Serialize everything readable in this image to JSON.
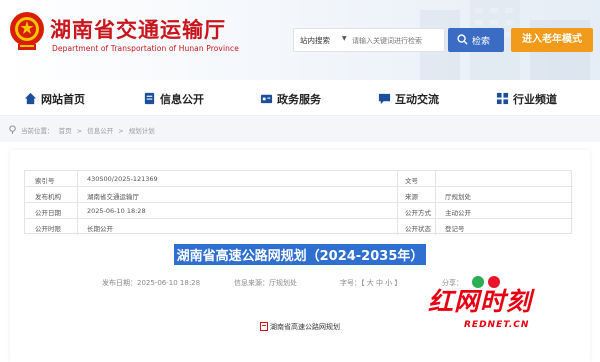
{
  "header": {
    "site_title": "湖南省交通运输厅",
    "site_subtitle": "Department of Transportation of Hunan Province",
    "search": {
      "scope": "站内搜索",
      "placeholder": "请输入关键词进行检索",
      "button_label": "检索"
    },
    "elder_mode_label": "进入老年模式",
    "colors": {
      "brand_red": "#c8161d",
      "search_blue": "#3b6cc4",
      "elder_orange": "#f29b1a"
    }
  },
  "nav": {
    "items": [
      {
        "label": "网站首页",
        "icon": "home-icon"
      },
      {
        "label": "信息公开",
        "icon": "document-icon"
      },
      {
        "label": "政务服务",
        "icon": "service-icon"
      },
      {
        "label": "互动交流",
        "icon": "chat-icon"
      },
      {
        "label": "行业频道",
        "icon": "grid-icon"
      }
    ]
  },
  "breadcrumb": {
    "prefix": "当前位置：",
    "items": [
      "首页",
      "信息公开",
      "规划计划"
    ],
    "separator": ">"
  },
  "meta": {
    "index_label": "索引号",
    "index_value": "430S00/2025-121369",
    "doc_no_label": "文号",
    "doc_no_value": "",
    "publisher_label": "发布机构",
    "publisher_value": "湖南省交通运输厅",
    "source_label": "来源",
    "source_value": "厅规划处",
    "date_label": "公开日期",
    "date_value": "2025-06-10 18:28",
    "method_label": "公开方式",
    "method_value": "主动公开",
    "period_label": "公开时限",
    "period_value": "长期公开",
    "status_label": "公开状态",
    "status_value": "登记号"
  },
  "article": {
    "title": "湖南省高速公路网规划（2024-2035年）",
    "publish_date": "发布日期：2025-06-10 18:28",
    "info_source": "信息来源：厅规划处",
    "font_size": "字号：【 大 中 小 】",
    "share_label": "分享：",
    "attachment": "湖南省高速公路网规划"
  },
  "watermark": {
    "main": "红网时刻",
    "sub": "REDNET.CN"
  }
}
